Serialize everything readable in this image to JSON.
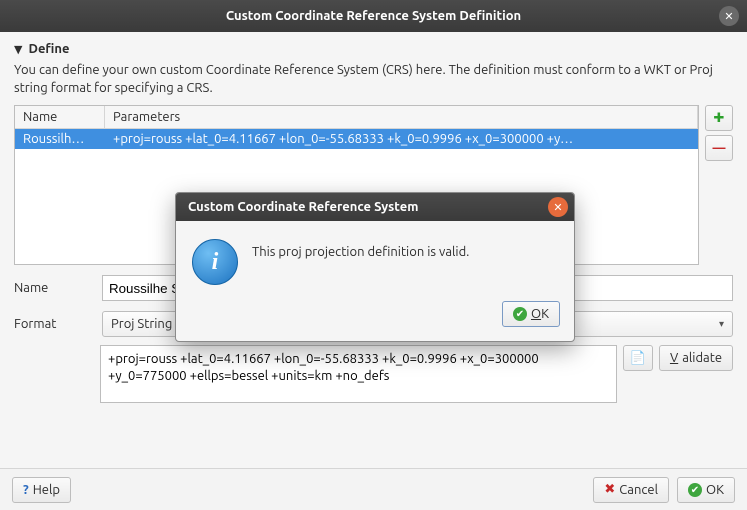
{
  "window": {
    "title": "Custom Coordinate Reference System Definition"
  },
  "group": {
    "label": "Define"
  },
  "intro": "You can define your own custom Coordinate Reference System (CRS) here. The definition must conform to a WKT or Proj string format for specifying a CRS.",
  "table": {
    "headers": {
      "name": "Name",
      "params": "Parameters"
    },
    "rows": [
      {
        "name": "Roussilh…",
        "params": "+proj=rouss +lat_0=4.11667 +lon_0=-55.68333 +k_0=0.9996 +x_0=300000 +y…"
      }
    ]
  },
  "form": {
    "name_label": "Name",
    "name_value": "Roussilhe Suriname",
    "format_label": "Format",
    "format_value": "Proj String (Legacy — Not Recommended)",
    "parameters_value": "+proj=rouss +lat_0=4.11667 +lon_0=-55.68333 +k_0=0.9996 +x_0=300000 +y_0=775000 +ellps=bessel +units=km +no_defs",
    "validate_prefix": "V",
    "validate_rest": "alidate"
  },
  "footer": {
    "help": "Help",
    "cancel": "Cancel",
    "ok": "OK"
  },
  "dialog": {
    "title": "Custom Coordinate Reference System",
    "message": "This proj projection definition is valid.",
    "ok_prefix": "O",
    "ok_rest": "K"
  }
}
